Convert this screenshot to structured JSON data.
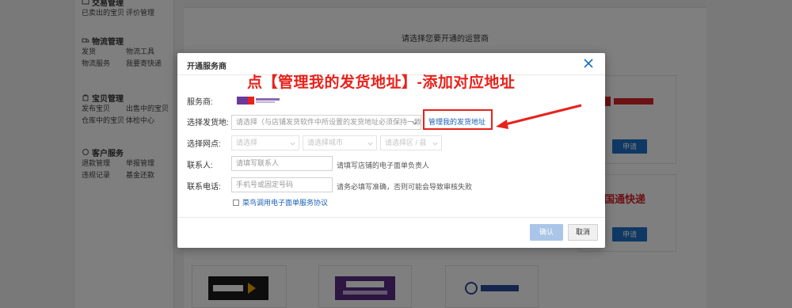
{
  "sidebar": {
    "groups": [
      {
        "title": "交易管理",
        "rows": [
          [
            "已卖出的宝贝",
            "评价管理"
          ]
        ]
      },
      {
        "title": "物流管理",
        "rows": [
          [
            "发货",
            "物流工具"
          ],
          [
            "物流服务",
            "我要寄快递"
          ]
        ]
      },
      {
        "title": "宝贝管理",
        "rows": [
          [
            "发布宝贝",
            "出售中的宝贝"
          ],
          [
            "仓库中的宝贝",
            "体检中心"
          ]
        ]
      },
      {
        "title": "客户服务",
        "rows": [
          [
            "退款管理",
            "举报管理"
          ],
          [
            "违规记录",
            "基金还款"
          ]
        ]
      }
    ]
  },
  "main": {
    "section_title": "请选择您要开通的运营商",
    "apply_label": "申请",
    "partial_logo_1": "国通快递"
  },
  "dialog": {
    "title": "开通服务商",
    "annotation": "点【管理我的发货地址】-添加对应地址",
    "provider_label": "服务商:",
    "address_label": "选择发货地:",
    "address_placeholder": "请选择（与店铺发货软件中所设置的发货地址必须保持一致",
    "manage_link": "管理我的发货地址",
    "branch_label": "选择网点:",
    "province_placeholder": "请选择",
    "city_placeholder": "请选择城市",
    "district_placeholder": "请选择区 / 县",
    "contact_label": "联系人:",
    "contact_placeholder": "请填写联系人",
    "contact_hint": "请填写店铺的电子面单负责人",
    "phone_label": "联系电话:",
    "phone_placeholder": "手机号或固定号码",
    "phone_hint": "请务必填写准确，否则可能会导致审核失败",
    "agreement": "菜鸟调用电子面单服务协议",
    "confirm_label": "确认",
    "cancel_label": "取消"
  },
  "colors": {
    "accent": "#1e73c9",
    "annotation": "#e8221b",
    "link": "#1a5fb4"
  }
}
